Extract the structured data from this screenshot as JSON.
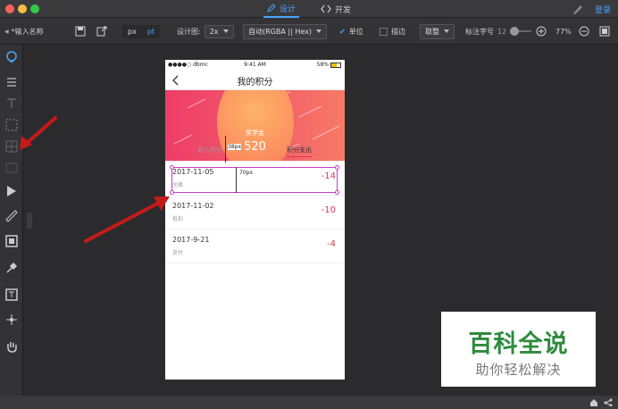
{
  "titlebar": {
    "tabs": [
      {
        "label": "设计",
        "icon": "pencil-icon",
        "active": true
      },
      {
        "label": "开发",
        "icon": "code-icon",
        "active": false
      }
    ],
    "login_label": "登录"
  },
  "toolbar": {
    "name_placeholder": "*输入名称",
    "unit_px": "px",
    "unit_pt": "pt",
    "design_label": "设计图:",
    "design_value": "2x",
    "color_value": "自动(RGBA || Hex)",
    "unit_check_label": "单位",
    "stroke_label": "描边",
    "round_value": "取整",
    "font_label": "标注字号",
    "font_value": "12",
    "zoom_value": "77%"
  },
  "sidebar": {
    "icons": [
      "lightbulb-icon",
      "slice-icon",
      "text-icon",
      "selection-icon",
      "grid-icon",
      "layer-icon",
      "play-icon",
      "ruler-icon",
      "frame-icon",
      "eyedropper-icon",
      "text-box-icon",
      "crosshair-icon",
      "hand-icon"
    ]
  },
  "phone": {
    "status_left": "●●●●○ dbmc",
    "status_time": "9:41 AM",
    "status_battery": "58%",
    "nav_title": "我的积分",
    "banner_label": "奖学金",
    "banner_value": "520",
    "tab_income": "收入积分",
    "tab_expense": "积分支出",
    "rows": [
      {
        "date": "2017-11-05",
        "type": "兑换",
        "points": "-14"
      },
      {
        "date": "2017-11-02",
        "type": "抵扣",
        "points": "-10"
      },
      {
        "date": "2017-9-21",
        "type": "支付",
        "points": "-4"
      }
    ]
  },
  "measure": {
    "width_label": "38px",
    "height_label": "70px"
  },
  "watermark": {
    "line1": "百科全说",
    "line2": "助你轻松解决"
  },
  "colors": {
    "accent": "#4aa3ff",
    "points": "#e5344f",
    "measure": "#c83cc8",
    "arrow": "#c41a1a"
  }
}
